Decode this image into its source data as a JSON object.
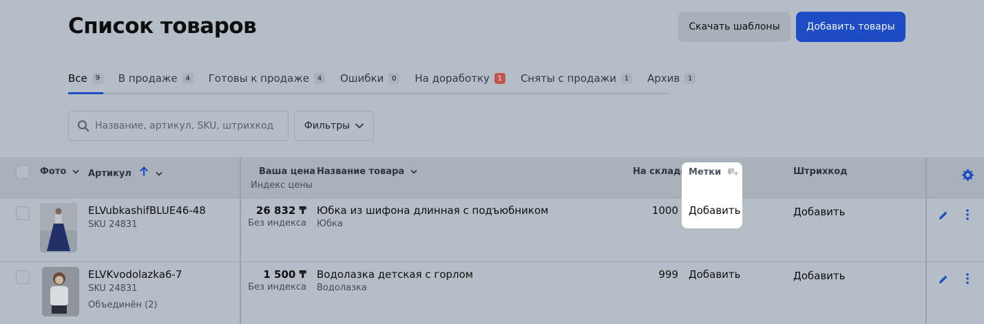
{
  "page": {
    "title": "Список товаров",
    "download_templates": "Скачать шаблоны",
    "add_products": "Добавить товары"
  },
  "tabs": [
    {
      "label": "Все",
      "count": "9",
      "active": true
    },
    {
      "label": "В продаже",
      "count": "4"
    },
    {
      "label": "Готовы к продаже",
      "count": "4"
    },
    {
      "label": "Ошибки",
      "count": "0"
    },
    {
      "label": "На доработку",
      "count": "1",
      "alert": true
    },
    {
      "label": "Сняты с продажи",
      "count": "1"
    },
    {
      "label": "Архив",
      "count": "1"
    }
  ],
  "search": {
    "placeholder": "Название, артикул, SKU, штрихкод"
  },
  "filters": {
    "label": "Фильтры"
  },
  "table": {
    "headers": {
      "photo": "Фото",
      "article": "Артикул",
      "price": "Ваша цена",
      "price_sub": "Индекс цены",
      "name": "Название товара",
      "stock": "На складе",
      "tags": "Метки",
      "barcode": "Штрихкод"
    },
    "rows": [
      {
        "article": "ELVubkashifBLUE46-48",
        "sku": "SKU 24831",
        "price": "26 832 ₸",
        "price_index": "Без индекса",
        "name": "Юбка из шифона длинная с подъюбником",
        "category": "Юбка",
        "stock": "1000",
        "tags": "Добавить",
        "barcode": "Добавить"
      },
      {
        "article": "ELVKvodolazka6-7",
        "sku": "SKU 24831",
        "merged": "Объединён (2)",
        "price": "1 500 ₸",
        "price_index": "Без индекса",
        "name": "Водолазка детская с горлом",
        "category": "Водолазка",
        "stock": "999",
        "tags": "Добавить",
        "barcode": "Добавить"
      }
    ]
  },
  "colors": {
    "accent": "#1d4cc4",
    "alert": "#c0574e",
    "overlay_bg": "#b5bdc6"
  }
}
